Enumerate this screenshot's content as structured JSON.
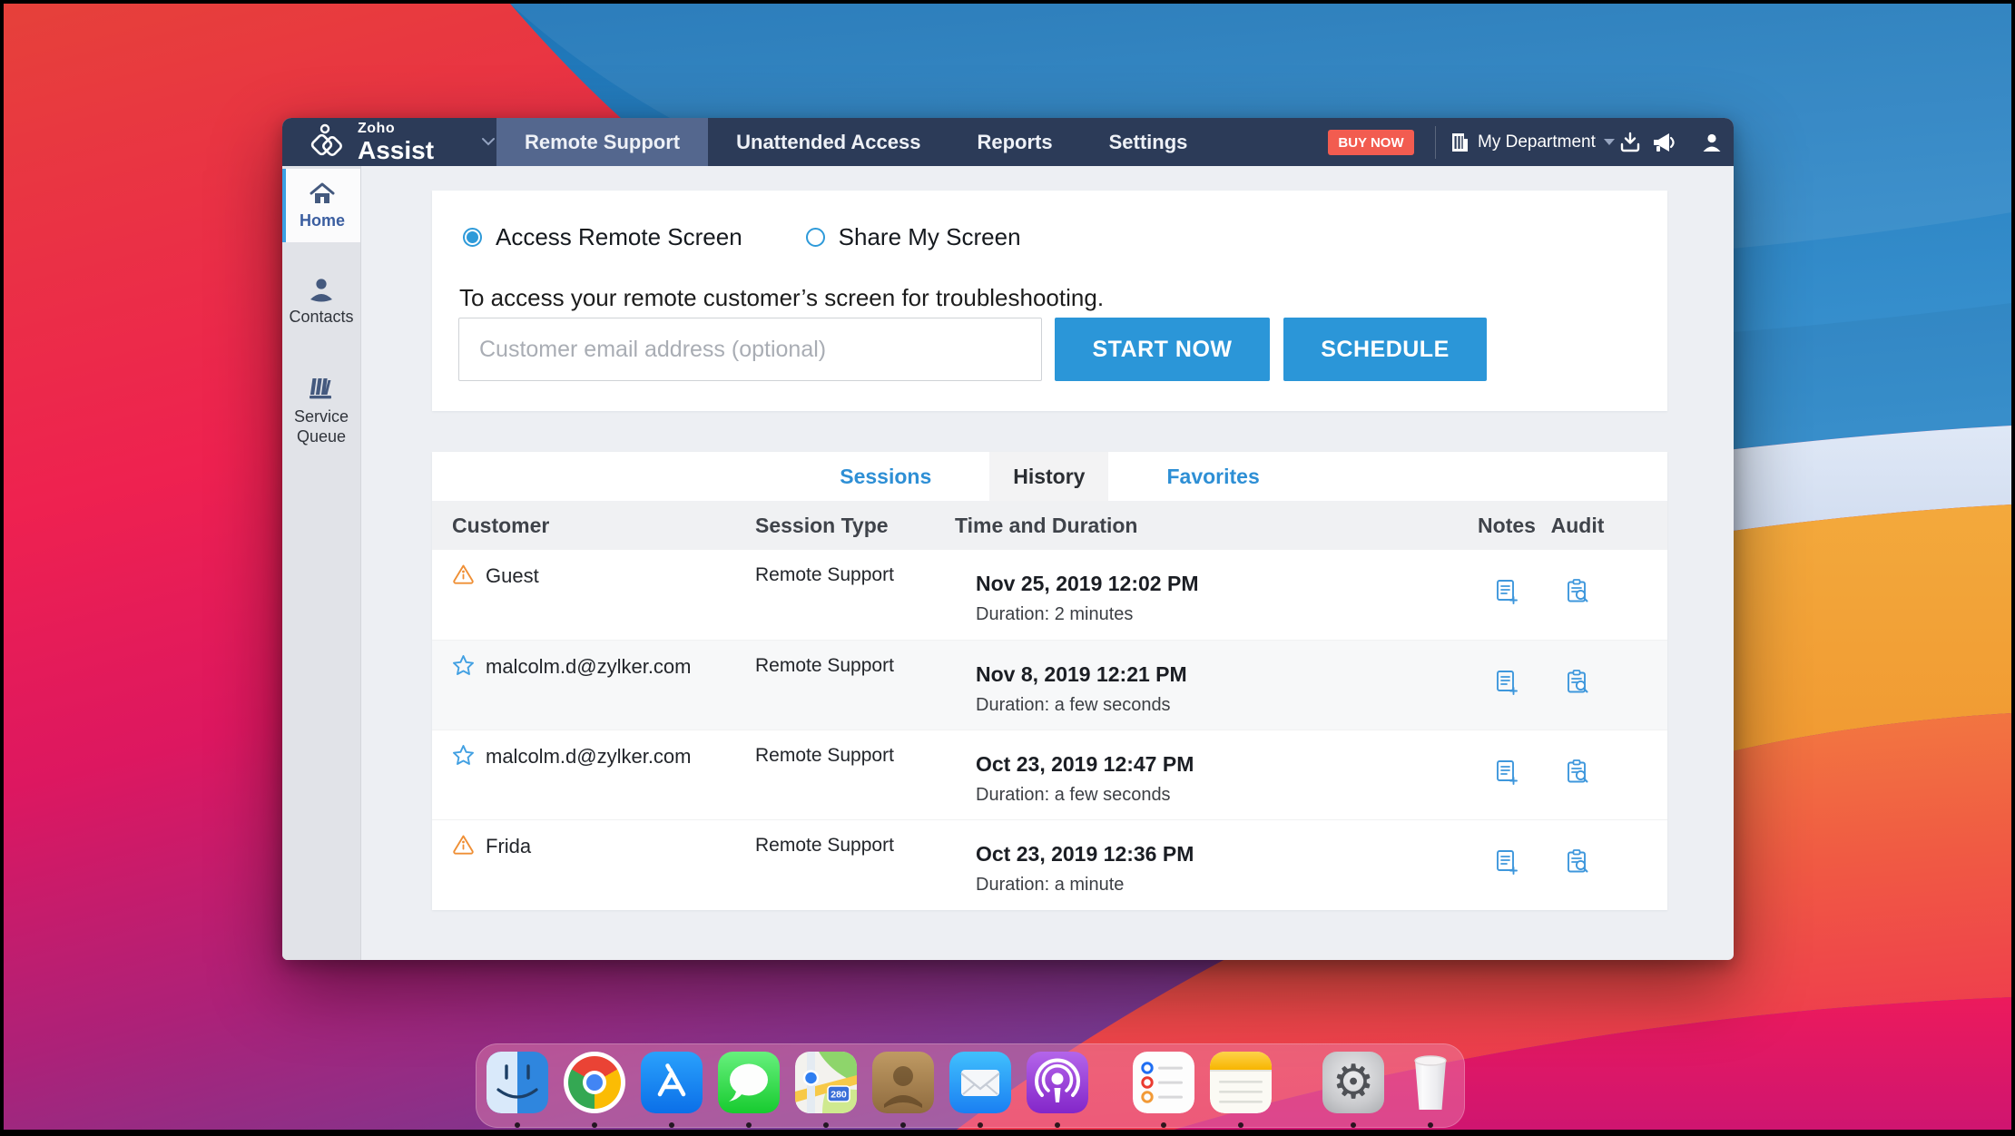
{
  "colors": {
    "navbar": "#2c3b58",
    "accent_blue": "#2b96d8",
    "buy_now_red": "#f25c50",
    "warning_orange": "#ef8f35",
    "star_blue": "#42a0e2",
    "tab_active_bg": "#54678e"
  },
  "navbar": {
    "logo_top": "Zoho",
    "logo_bottom": "Assist",
    "tabs": [
      {
        "label": "Remote Support"
      },
      {
        "label": "Unattended Access"
      },
      {
        "label": "Reports"
      },
      {
        "label": "Settings"
      }
    ],
    "buy_now": "BUY NOW",
    "department": "My Department"
  },
  "sidebar": {
    "items": [
      {
        "label": "Home"
      },
      {
        "label": "Contacts"
      },
      {
        "label": "Service Queue"
      }
    ]
  },
  "session_panel": {
    "radio_access": "Access Remote Screen",
    "radio_share": "Share My Screen",
    "description": "To access your remote customer’s screen for troubleshooting.",
    "email_placeholder": "Customer email address (optional)",
    "start_button": "START NOW",
    "schedule_button": "SCHEDULE"
  },
  "history_panel": {
    "tabs": [
      {
        "label": "Sessions"
      },
      {
        "label": "History"
      },
      {
        "label": "Favorites"
      }
    ],
    "active_tab": "History",
    "columns": [
      "Customer",
      "Session Type",
      "Time and Duration",
      "Notes",
      "Audit"
    ],
    "rows": [
      {
        "icon": "warning",
        "customer": "Guest",
        "type": "Remote Support",
        "time": "Nov 25, 2019 12:02 PM",
        "duration": "Duration: 2 minutes"
      },
      {
        "icon": "star",
        "customer": "malcolm.d@zylker.com",
        "type": "Remote Support",
        "time": "Nov 8, 2019 12:21 PM",
        "duration": "Duration: a few seconds"
      },
      {
        "icon": "star",
        "customer": "malcolm.d@zylker.com",
        "type": "Remote Support",
        "time": "Oct 23, 2019 12:47 PM",
        "duration": "Duration: a few seconds"
      },
      {
        "icon": "warning",
        "customer": "Frida",
        "type": "Remote Support",
        "time": "Oct 23, 2019 12:36 PM",
        "duration": "Duration: a minute"
      }
    ]
  },
  "dock": {
    "apps": [
      "Finder",
      "Chrome",
      "App Store",
      "Messages",
      "Maps",
      "Contacts",
      "Mail",
      "Podcasts",
      "Reminders",
      "Notes",
      "System Preferences",
      "Trash"
    ],
    "maps_badge": "280"
  }
}
